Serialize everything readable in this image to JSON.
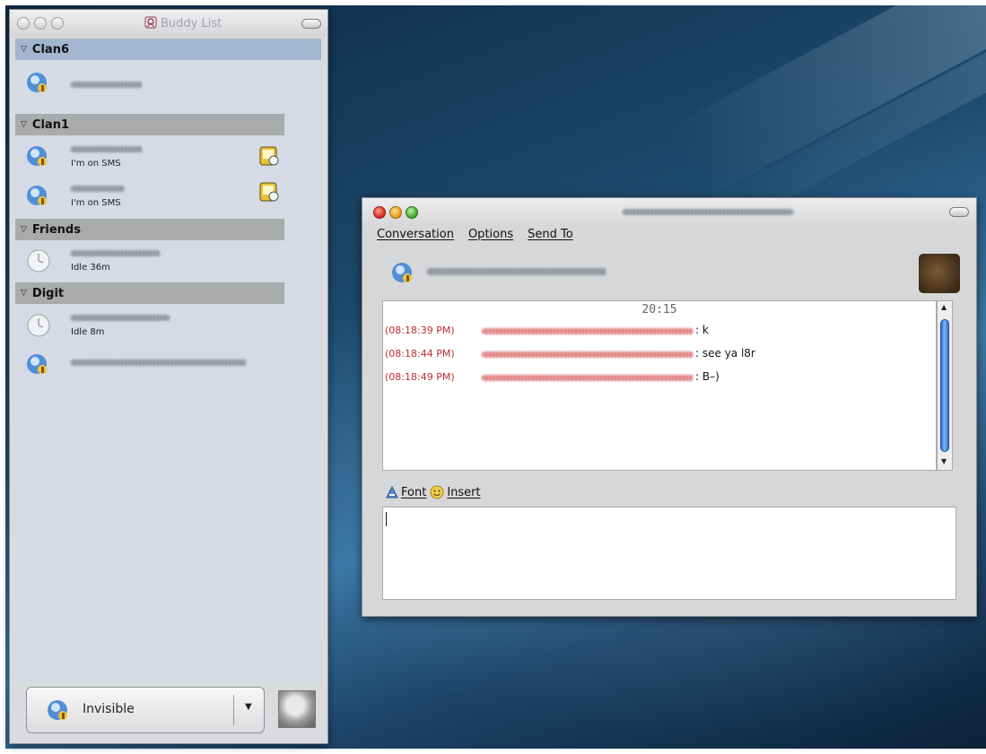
{
  "buddy_list": {
    "title": "Buddy List",
    "groups": [
      {
        "name": "Clan6",
        "selected": true,
        "contacts": [
          {
            "status": ""
          }
        ]
      },
      {
        "name": "Clan1",
        "selected": false,
        "contacts": [
          {
            "status": "I'm on SMS"
          },
          {
            "status": "I'm on SMS"
          }
        ]
      },
      {
        "name": "Friends",
        "selected": false,
        "contacts": [
          {
            "status": "Idle 36m"
          }
        ]
      },
      {
        "name": "Digit",
        "selected": false,
        "contacts": [
          {
            "status": "Idle 8m"
          },
          {
            "status": ""
          }
        ]
      }
    ],
    "status_selector": {
      "value": "Invisible"
    }
  },
  "conversation": {
    "menu": {
      "conversation": "Conversation",
      "options": "Options",
      "send_to": "Send To"
    },
    "time_marker": "20:15",
    "messages": [
      {
        "time": "(08:18:39 PM)",
        "text": ": k"
      },
      {
        "time": "(08:18:44 PM)",
        "text": ": see ya l8r"
      },
      {
        "time": "(08:18:49 PM)",
        "text": ": B–)"
      }
    ],
    "toolbar": {
      "font": "Font",
      "insert": "Insert"
    },
    "input_value": ""
  },
  "colors": {
    "group_header": "#a9aaab",
    "group_selected": "#a3b6cf",
    "timestamp_red": "#c02d2d",
    "scroll_thumb": "#2e6fd0"
  }
}
